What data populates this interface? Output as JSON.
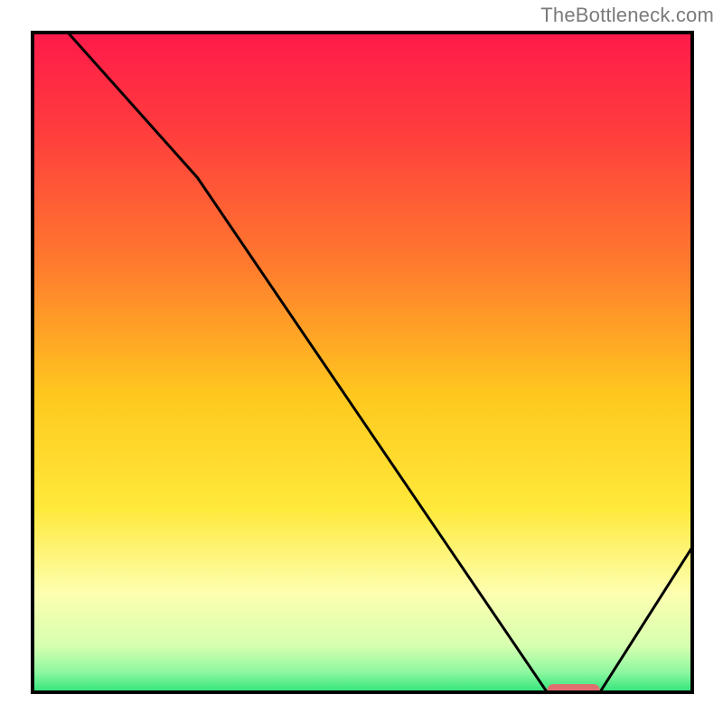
{
  "attribution": "TheBottleneck.com",
  "chart_data": {
    "type": "line",
    "title": "",
    "xlabel": "",
    "ylabel": "",
    "xlim": [
      0,
      100
    ],
    "ylim": [
      0,
      100
    ],
    "grid": false,
    "legend": false,
    "x": [
      0,
      25,
      78,
      86,
      100
    ],
    "values": [
      106,
      78,
      0,
      0,
      22
    ],
    "marker": {
      "x_start": 78,
      "x_end": 86,
      "y": 0,
      "color": "#e07070"
    },
    "gradient_stops": [
      {
        "offset": 0.0,
        "color": "#ff1a4b"
      },
      {
        "offset": 0.15,
        "color": "#ff3d3d"
      },
      {
        "offset": 0.35,
        "color": "#ff7a2e"
      },
      {
        "offset": 0.55,
        "color": "#ffc81e"
      },
      {
        "offset": 0.72,
        "color": "#ffe93a"
      },
      {
        "offset": 0.85,
        "color": "#fdffb0"
      },
      {
        "offset": 0.93,
        "color": "#d6ffb0"
      },
      {
        "offset": 0.97,
        "color": "#8cf7a0"
      },
      {
        "offset": 1.0,
        "color": "#2fe47a"
      }
    ],
    "frame_color": "#000000",
    "curve_color": "#000000"
  }
}
